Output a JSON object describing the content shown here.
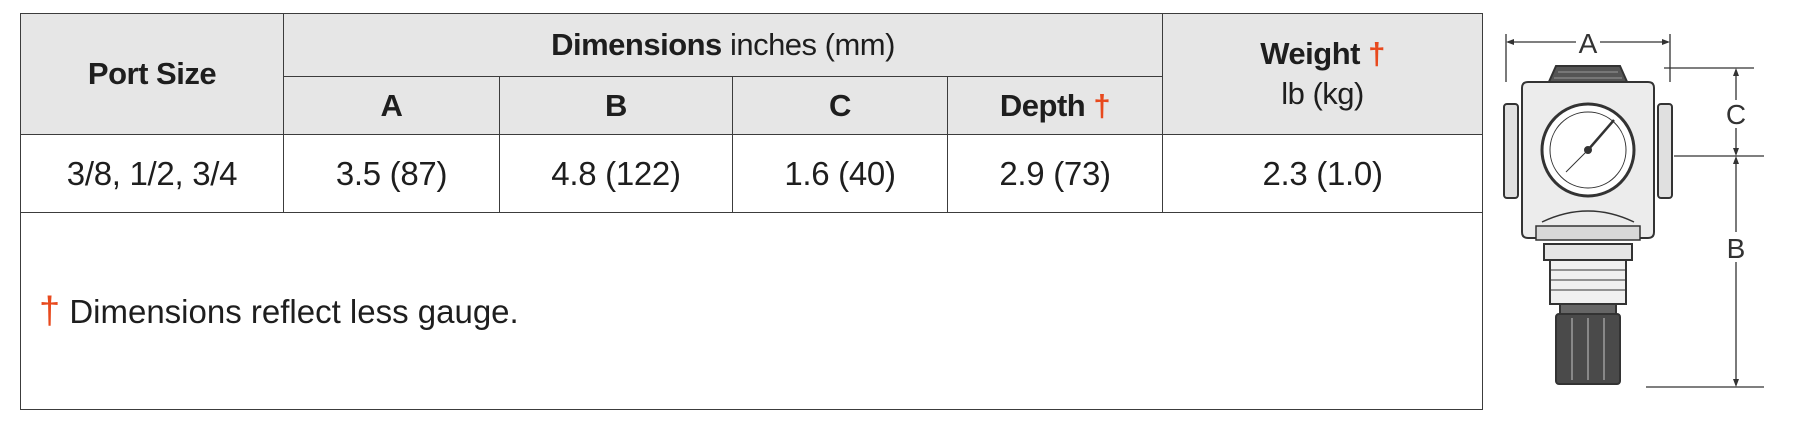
{
  "table": {
    "port_size_header": "Port Size",
    "dimensions_header_bold": "Dimensions",
    "dimensions_header_units": "inches (mm)",
    "weight_header": "Weight",
    "weight_units": "lb (kg)",
    "dagger": "†",
    "sub_headers": {
      "a": "A",
      "b": "B",
      "c": "C",
      "depth": "Depth"
    },
    "row": {
      "port_size": "3/8, 1/2, 3/4",
      "a": "3.5 (87)",
      "b": "4.8 (122)",
      "c": "1.6 (40)",
      "depth": "2.9 (73)",
      "weight": "2.3 (1.0)"
    },
    "note": "Dimensions reflect less gauge."
  },
  "drawing": {
    "label_a": "A",
    "label_b": "B",
    "label_c": "C"
  },
  "colors": {
    "accent": "#e8491d",
    "header_bg": "#e6e6e6",
    "border": "#3c3c3c"
  }
}
